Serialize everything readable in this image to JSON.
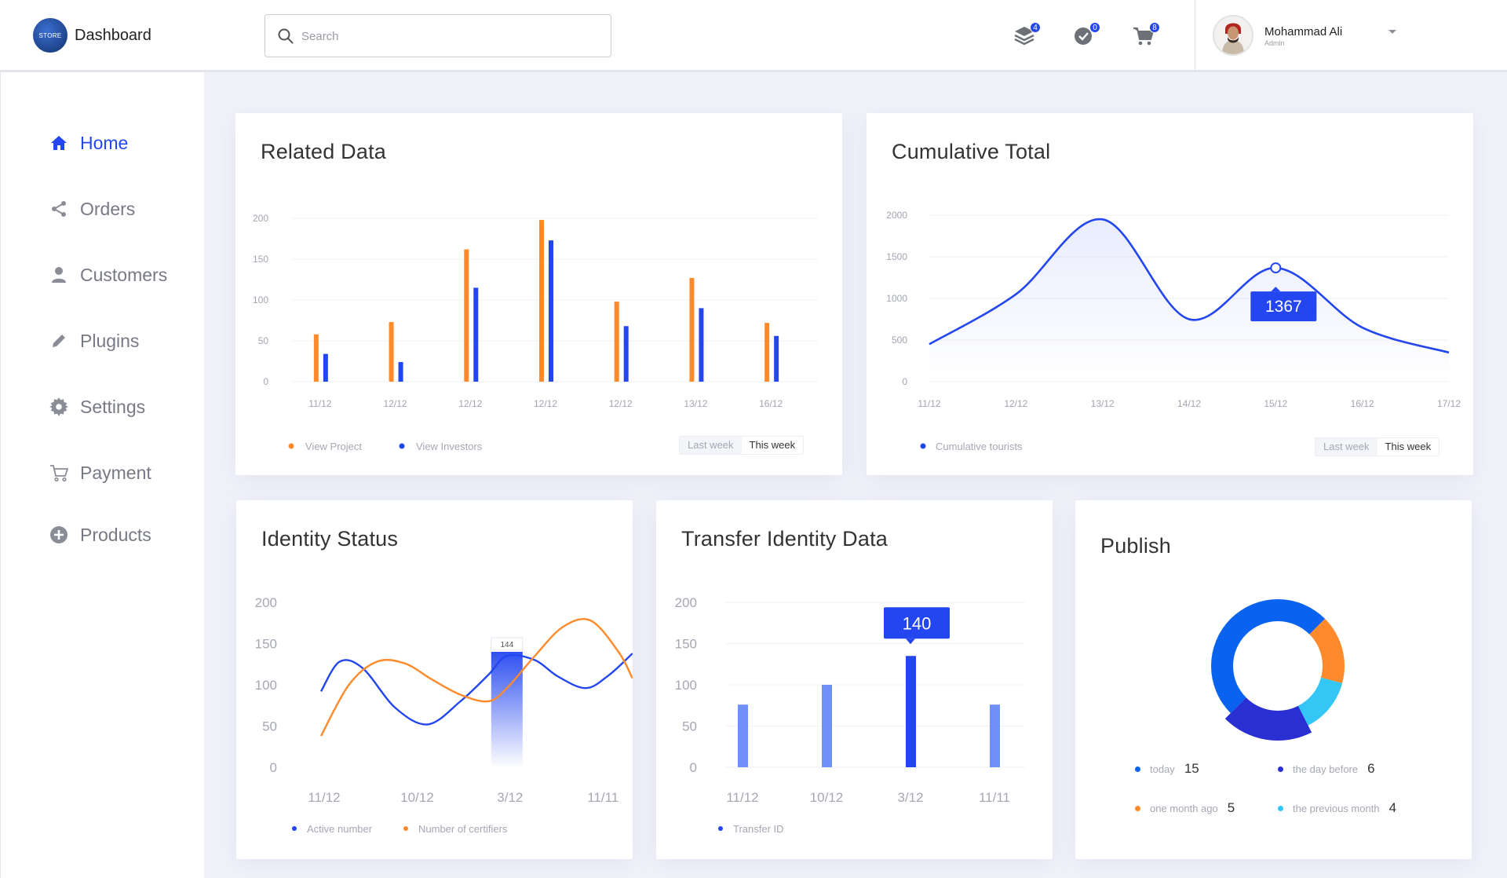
{
  "header": {
    "logo_text": "STORE",
    "title": "Dashboard",
    "search_placeholder": "Search",
    "icons": [
      {
        "name": "layers-icon",
        "badge": "4"
      },
      {
        "name": "check-circle-icon",
        "badge": "0"
      },
      {
        "name": "cart-icon",
        "badge": "8"
      }
    ],
    "user": {
      "name": "Mohammad Ali",
      "role": "Admin"
    }
  },
  "sidebar": {
    "items": [
      {
        "label": "Home",
        "icon": "home-icon",
        "active": true
      },
      {
        "label": "Orders",
        "icon": "share-icon",
        "active": false
      },
      {
        "label": "Customers",
        "icon": "user-icon",
        "active": false
      },
      {
        "label": "Plugins",
        "icon": "pencil-icon",
        "active": false
      },
      {
        "label": "Settings",
        "icon": "gear-icon",
        "active": false
      },
      {
        "label": "Payment",
        "icon": "cart-icon",
        "active": false
      },
      {
        "label": "Products",
        "icon": "plus-circle-icon",
        "active": false
      }
    ]
  },
  "colors": {
    "accent": "#2346f0",
    "orange": "#ff8a2b",
    "blue": "#2346f0",
    "light_blue": "#6f8ff9",
    "cyan": "#34c6f4",
    "mid_blue": "#0a63f0"
  },
  "cards": {
    "related": {
      "title": "Related Data",
      "toggle": [
        "Last week",
        "This week"
      ]
    },
    "cumulative": {
      "title": "Cumulative Total",
      "toggle": [
        "Last week",
        "This week"
      ]
    },
    "identity": {
      "title": "Identity Status"
    },
    "transfer": {
      "title": "Transfer Identity Data"
    },
    "publish": {
      "title": "Publish",
      "legend": [
        {
          "label": "today",
          "value": "15",
          "color": "#0a63f0"
        },
        {
          "label": "the day before",
          "value": "6",
          "color": "#2a2fd4"
        },
        {
          "label": "one month ago",
          "value": "5",
          "color": "#ff8a2b"
        },
        {
          "label": "the previous month",
          "value": "4",
          "color": "#34c6f4"
        }
      ]
    }
  },
  "chart_data": [
    {
      "type": "bar",
      "title": "Related Data",
      "categories": [
        "11/12",
        "12/12",
        "12/12",
        "12/12",
        "12/12",
        "13/12",
        "16/12"
      ],
      "series": [
        {
          "name": "View Project",
          "color": "#ff8a2b",
          "values": [
            58,
            73,
            162,
            198,
            98,
            127,
            72
          ]
        },
        {
          "name": "View Investors",
          "color": "#2346f0",
          "values": [
            34,
            24,
            115,
            173,
            68,
            90,
            56
          ]
        }
      ],
      "y_ticks": [
        "200",
        "150",
        "100",
        "50",
        "0"
      ],
      "ylim": [
        0,
        200
      ],
      "legend": "bottom-left",
      "grid": true
    },
    {
      "type": "area",
      "title": "Cumulative Total",
      "categories": [
        "11/12",
        "12/12",
        "13/12",
        "14/12",
        "15/12",
        "16/12",
        "17/12"
      ],
      "series": [
        {
          "name": "Cumulative tourists",
          "color": "#2346f0",
          "values": [
            450,
            1050,
            1950,
            750,
            1367,
            650,
            350
          ]
        }
      ],
      "y_ticks": [
        "2000",
        "1500",
        "1000",
        "500",
        "0"
      ],
      "ylim": [
        0,
        2000
      ],
      "highlight": {
        "index": 4,
        "label": "1367"
      },
      "legend": "bottom-left",
      "grid": true
    },
    {
      "type": "line",
      "title": "Identity Status",
      "categories": [
        "11/12",
        "10/12",
        "3/12",
        "11/11"
      ],
      "series": [
        {
          "name": "Active number",
          "color": "#2346f0",
          "x": [
            0,
            0.2,
            0.45,
            0.8,
            1.15,
            1.5,
            1.8,
            2.0,
            2.3,
            2.55,
            2.85,
            3.1,
            3.35
          ],
          "values": [
            92,
            128,
            120,
            72,
            52,
            80,
            112,
            135,
            130,
            110,
            96,
            112,
            138
          ]
        },
        {
          "name": "Number of certifiers",
          "color": "#ff8a2b",
          "x": [
            0,
            0.3,
            0.6,
            0.9,
            1.2,
            1.5,
            1.8,
            2.0,
            2.3,
            2.6,
            2.9,
            3.2,
            3.35
          ],
          "values": [
            38,
            100,
            128,
            126,
            106,
            88,
            80,
            96,
            135,
            170,
            178,
            140,
            108
          ]
        }
      ],
      "y_ticks": [
        "200",
        "150",
        "100",
        "50",
        "0"
      ],
      "ylim": [
        0,
        200
      ],
      "highlight": {
        "x": 2,
        "label": "144"
      },
      "legend": "bottom-left"
    },
    {
      "type": "bar",
      "title": "Transfer Identity Data",
      "categories": [
        "11/12",
        "10/12",
        "3/12",
        "11/11"
      ],
      "series": [
        {
          "name": "Transfer ID",
          "color": "#6f8ff9",
          "values": [
            76,
            100,
            135,
            76
          ]
        }
      ],
      "y_ticks": [
        "200",
        "150",
        "100",
        "50",
        "0"
      ],
      "ylim": [
        0,
        200
      ],
      "highlight": {
        "index": 2,
        "label": "140"
      },
      "legend": "bottom-left"
    },
    {
      "type": "pie",
      "title": "Publish",
      "labels": [
        "today",
        "the day before",
        "one month ago",
        "the previous month"
      ],
      "values": [
        15,
        6,
        5,
        4
      ],
      "colors": [
        "#0a63f0",
        "#2a2fd4",
        "#ff8a2b",
        "#34c6f4"
      ]
    }
  ]
}
